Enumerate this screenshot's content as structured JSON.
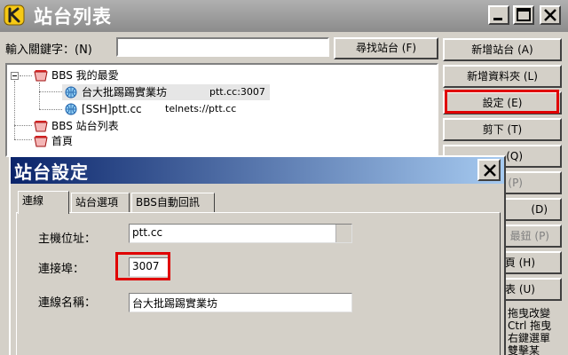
{
  "window": {
    "title": "站台列表"
  },
  "search": {
    "label": "輸入關鍵字：(N)",
    "value": "",
    "button": "尋找站台 (F)"
  },
  "tree": {
    "items": [
      {
        "label": "BBS 我的最愛",
        "host": ""
      },
      {
        "label": "台大批踢踢實業坊",
        "host": "ptt.cc:3007"
      },
      {
        "label": "[SSH]ptt.cc",
        "host": "telnets://ptt.cc"
      },
      {
        "label": "BBS 站台列表",
        "host": ""
      },
      {
        "label": "首頁",
        "host": ""
      }
    ]
  },
  "buttons": {
    "add_site": "新增站台 (A)",
    "add_folder": "新增資料夾 (L)",
    "settings": "設定 (E)",
    "cut": "剪下 (T)",
    "b5": "(Q)",
    "b6": "(P)",
    "b7": "(D)",
    "b8": "最鈕 (P)",
    "b9": "頁 (H)",
    "b10": "表 (U)"
  },
  "notes": [
    "拖曳改變",
    "Ctrl 拖曳",
    "右鍵選單",
    "雙擊某"
  ],
  "dialog": {
    "title": "站台設定",
    "tabs": [
      "連線",
      "站台選項",
      "BBS自動回訊"
    ],
    "fields": {
      "host_label": "主機位址：",
      "host_value": "ptt.cc",
      "port_label": "連接埠：",
      "port_value": "3007",
      "name_label": "連線名稱：",
      "name_value": "台大批踢踢實業坊"
    }
  },
  "colors": {
    "highlight": "#e00000",
    "dialog_title_start": "#0a246a",
    "dialog_title_end": "#a6caf0"
  }
}
